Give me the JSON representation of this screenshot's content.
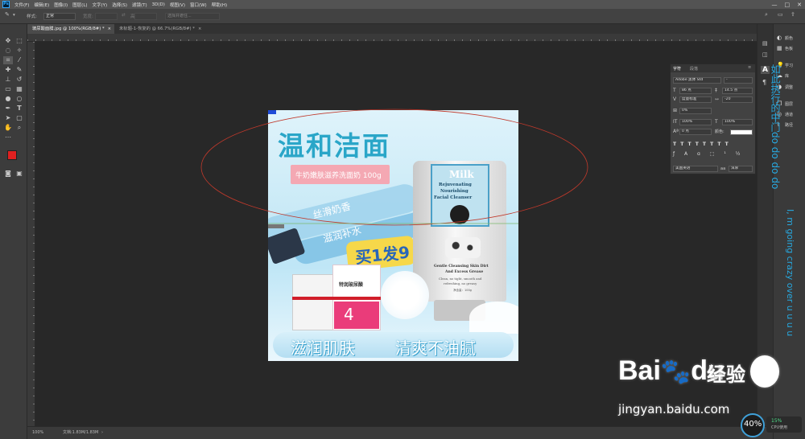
{
  "menubar": {
    "items": [
      "文件(F)",
      "编辑(E)",
      "图像(I)",
      "图层(L)",
      "文字(Y)",
      "选择(S)",
      "滤镜(T)",
      "3D(D)",
      "视图(V)",
      "窗口(W)",
      "帮助(H)"
    ],
    "logo": "Ps",
    "win_min": "—",
    "win_max": "□",
    "win_close": "✕"
  },
  "options": {
    "style_label": "样式:",
    "style_value": "正常",
    "width_label": "宽度:",
    "height_label": "高度:",
    "refine_label": "选择并遮住..."
  },
  "tabs": [
    {
      "label": "玻尿酸面膜.jpg @ 100%(RGB/8#) *",
      "close": "×"
    },
    {
      "label": "未标题-1-恢复的 @ 66.7%(RGB/8#) *",
      "close": "×"
    }
  ],
  "status": {
    "zoom": "100%",
    "doc": "文档:1.83M/1.83M"
  },
  "artwork": {
    "title": "温和洁面",
    "subtitle": "牛奶嫩肤滋养洗面奶 100g",
    "bubble1": "丝滑奶香",
    "bubble2": "滋润补水",
    "promo": "买1发9",
    "tube_brand": "Milk",
    "tube_line1": "Rejuvenating",
    "tube_line2": "Nourishing",
    "tube_line3": "Facial Cleanser",
    "tube_desc1": "Gentle Cleansing Skin Dirt",
    "tube_desc2": "And Excess Grease",
    "tube_desc3": "Clean, no tight, smooth and",
    "tube_desc4": "refreshing, no greasy",
    "tube_net": "净含量：100g",
    "mask_title": "特润玻尿酸",
    "mask_num": "4",
    "bottom_left": "滋润肌肤",
    "bottom_right": "清爽不油腻"
  },
  "char_panel": {
    "tab1": "字符",
    "tab2": "段落",
    "font_family": "Adobe 黑体 Std",
    "font_style": "-",
    "font_size": "86 点",
    "leading": "14.5 点",
    "kerning": "度量标准",
    "tracking": "-20",
    "scale_pct": "0%",
    "v_scale": "100%",
    "h_scale": "100%",
    "baseline": "0 点",
    "color_label": "颜色:",
    "lang": "美国英语",
    "aa": "浑厚",
    "aa_prefix": "aa"
  },
  "right_panel": {
    "items": [
      "颜色",
      "色板",
      "学习",
      "库",
      "调整",
      "图层",
      "通道",
      "路径"
    ]
  },
  "watermark": {
    "brand_left": "Bai",
    "brand_mid": "du",
    "brand_cn": "经验",
    "url": "jingyan.baidu.com"
  },
  "side_text": {
    "line1": "如此执行的中门do do do do",
    "line2": "I, m going crazy over u u u u"
  },
  "cpu": {
    "pct": "40%",
    "cpu_pct": "15%",
    "cpu_label": "CPU使用"
  },
  "colors": {
    "fg": "#e02020",
    "bg": "#d81f26",
    "accent": "#31a8ff"
  }
}
